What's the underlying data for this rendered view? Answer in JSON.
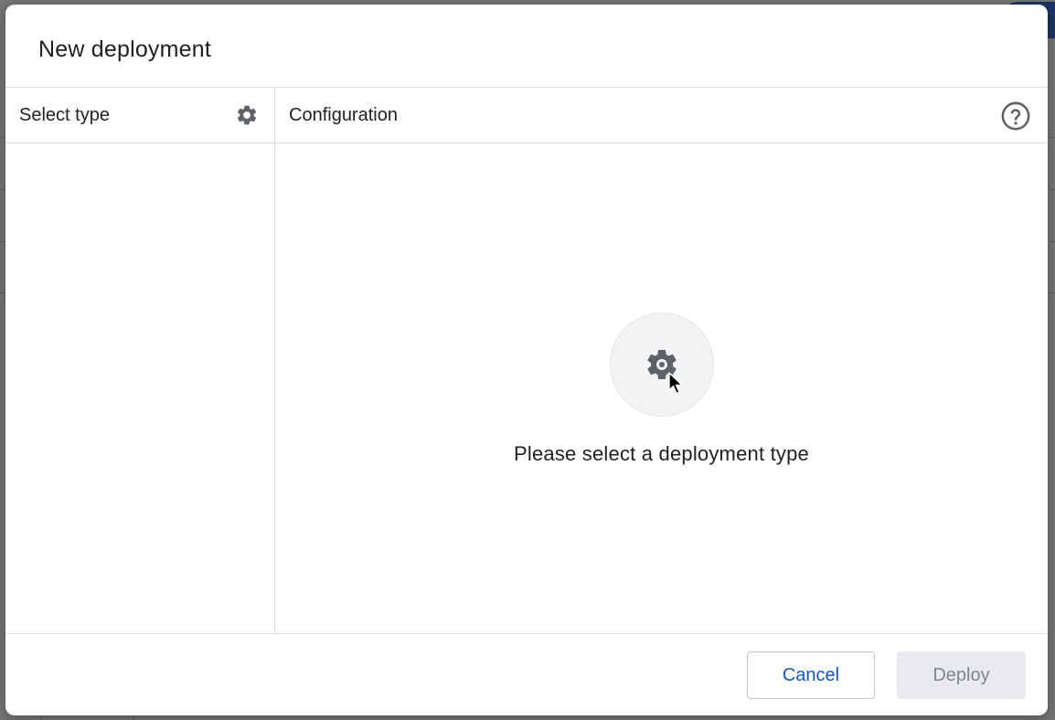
{
  "dialog": {
    "title": "New deployment"
  },
  "left_pane": {
    "title": "Select type",
    "settings_icon": "gear-icon"
  },
  "right_pane": {
    "title": "Configuration",
    "help_icon": "help-circle-icon",
    "empty_state": {
      "icon": "gear-icon",
      "message": "Please select a deployment type"
    }
  },
  "footer": {
    "cancel_label": "Cancel",
    "deploy_label": "Deploy",
    "deploy_enabled": false
  },
  "colors": {
    "primary": "#0b57d0",
    "disabled_bg": "#e8eaed",
    "disabled_text": "#80868b",
    "divider": "#dadce0"
  }
}
